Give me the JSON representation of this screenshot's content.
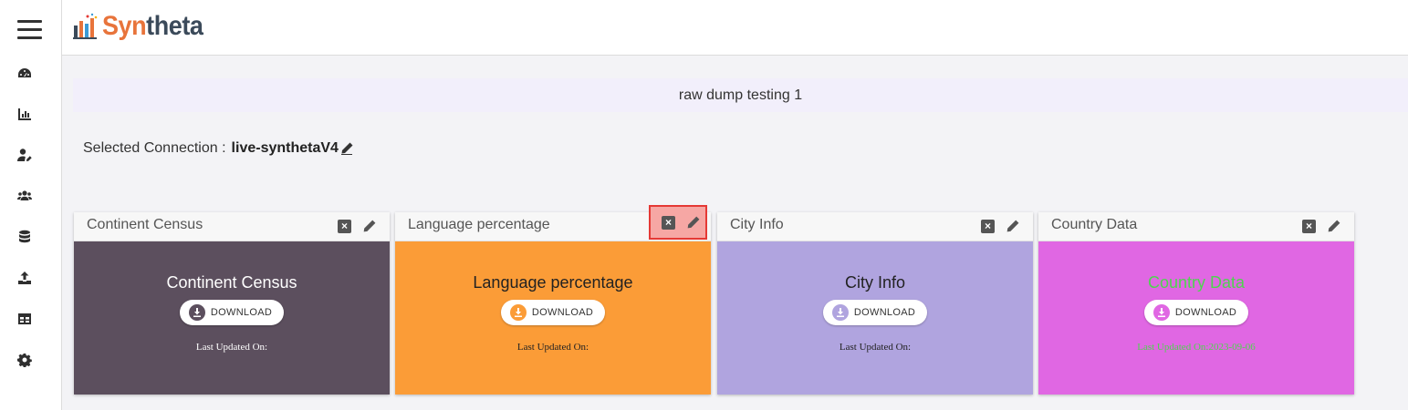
{
  "brand": {
    "part1": "Syn",
    "part2": "theta"
  },
  "sidebar": {
    "items": [
      {
        "icon": "dashboard-icon"
      },
      {
        "icon": "chart-icon"
      },
      {
        "icon": "user-edit-icon"
      },
      {
        "icon": "users-icon"
      },
      {
        "icon": "database-icon"
      },
      {
        "icon": "upload-icon"
      },
      {
        "icon": "table-icon"
      },
      {
        "icon": "gear-icon"
      }
    ]
  },
  "banner": {
    "title": "raw dump testing 1"
  },
  "connection": {
    "label": "Selected Connection :",
    "value": "live-synthetaV4"
  },
  "cards": [
    {
      "title": "Continent Census",
      "body_title": "Continent Census",
      "download_label": "DOWNLOAD",
      "updated": "Last Updated On:",
      "bg": "#5c4f5e",
      "text_color": "#ffffff",
      "download_icon_color": "#5c4f5e"
    },
    {
      "title": "Language percentage",
      "body_title": "Language percentage",
      "download_label": "DOWNLOAD",
      "updated": "Last Updated On:",
      "bg": "#fb9c37",
      "text_color": "#222222",
      "download_icon_color": "#fb9c37"
    },
    {
      "title": "City Info",
      "body_title": "City Info",
      "download_label": "DOWNLOAD",
      "updated": "Last Updated On:",
      "bg": "#b0a4df",
      "text_color": "#222222",
      "download_icon_color": "#b0a4df"
    },
    {
      "title": "Country Data",
      "body_title": "Country Data",
      "download_label": "DOWNLOAD",
      "updated": "Last Updated On:2023-09-06",
      "bg": "#e067e3",
      "text_color": "#4fd44f",
      "download_icon_color": "#e067e3"
    }
  ]
}
